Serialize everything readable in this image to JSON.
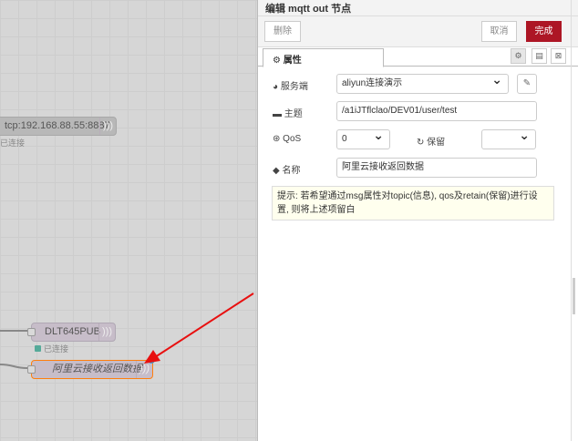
{
  "canvas": {
    "nodes": [
      {
        "label": "tcp:192.168.88.55:8887",
        "status": "已连接"
      },
      {
        "label": "DLT645PUB",
        "status": "已连接"
      },
      {
        "label": "阿里云接收返回数据"
      }
    ]
  },
  "panel": {
    "title": "编辑 mqtt out 节点",
    "buttons": {
      "delete": "删除",
      "cancel": "取消",
      "done": "完成"
    },
    "tab": "属性",
    "fields": {
      "server_label": "服务端",
      "server_value": "aliyun连接演示",
      "topic_label": "主题",
      "topic_value": "/a1iJTflclao/DEV01/user/test",
      "qos_label": "QoS",
      "qos_value": "0",
      "retain_label": "保留",
      "retain_value": "",
      "name_label": "名称",
      "name_value": "阿里云接收返回数据"
    },
    "tip": "提示: 若希望通过msg属性对topic(信息), qos及retain(保留)进行设置, 则将上述项留白"
  },
  "colors": {
    "done": "#ad1625",
    "arrow": "#e81010",
    "selected_node": "#ff7f0e"
  }
}
